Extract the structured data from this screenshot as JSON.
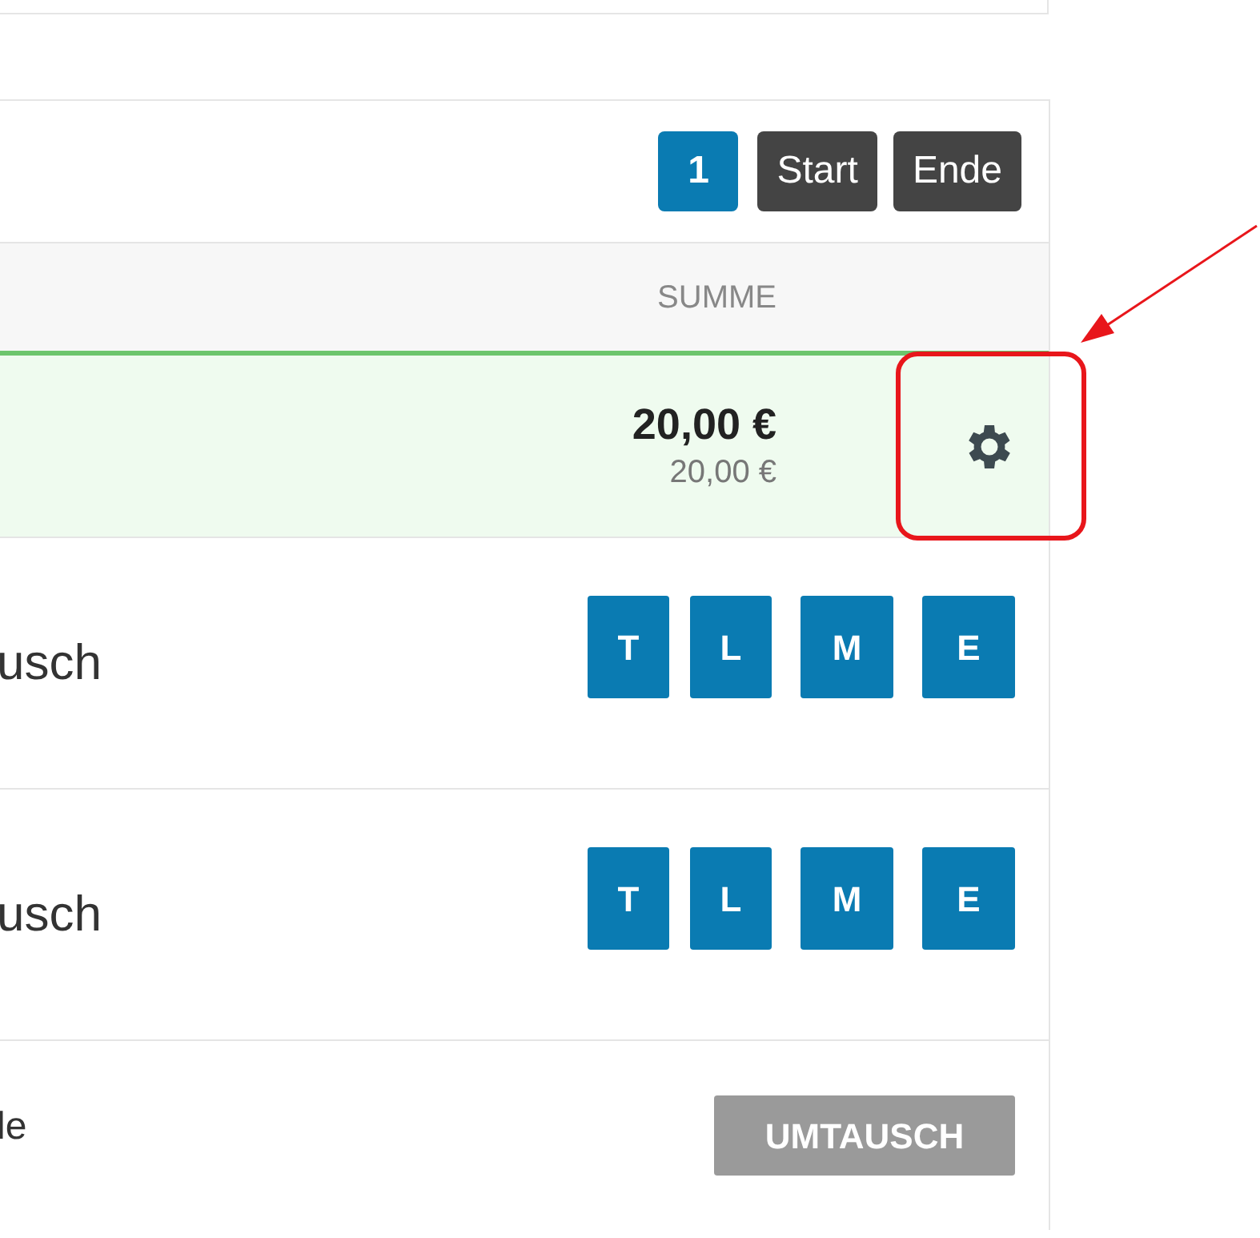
{
  "pagination": {
    "pages": [
      {
        "label": "1",
        "selected": true
      }
    ],
    "buttons": [
      "Start",
      "Ende"
    ]
  },
  "header": {
    "column_sum": "SUMME"
  },
  "rows": [
    {
      "kind": "total",
      "highlighted": true,
      "amount": "20,00 €",
      "sub_amount": "20,00 €"
    },
    {
      "kind": "buttons",
      "label": "usch",
      "buttons": [
        "T",
        "L",
        "M",
        "E"
      ]
    },
    {
      "kind": "buttons",
      "label": "usch",
      "buttons": [
        "T",
        "L",
        "M",
        "E"
      ]
    },
    {
      "kind": "action",
      "label": "le",
      "button": "UMTAUSCH"
    }
  ]
}
